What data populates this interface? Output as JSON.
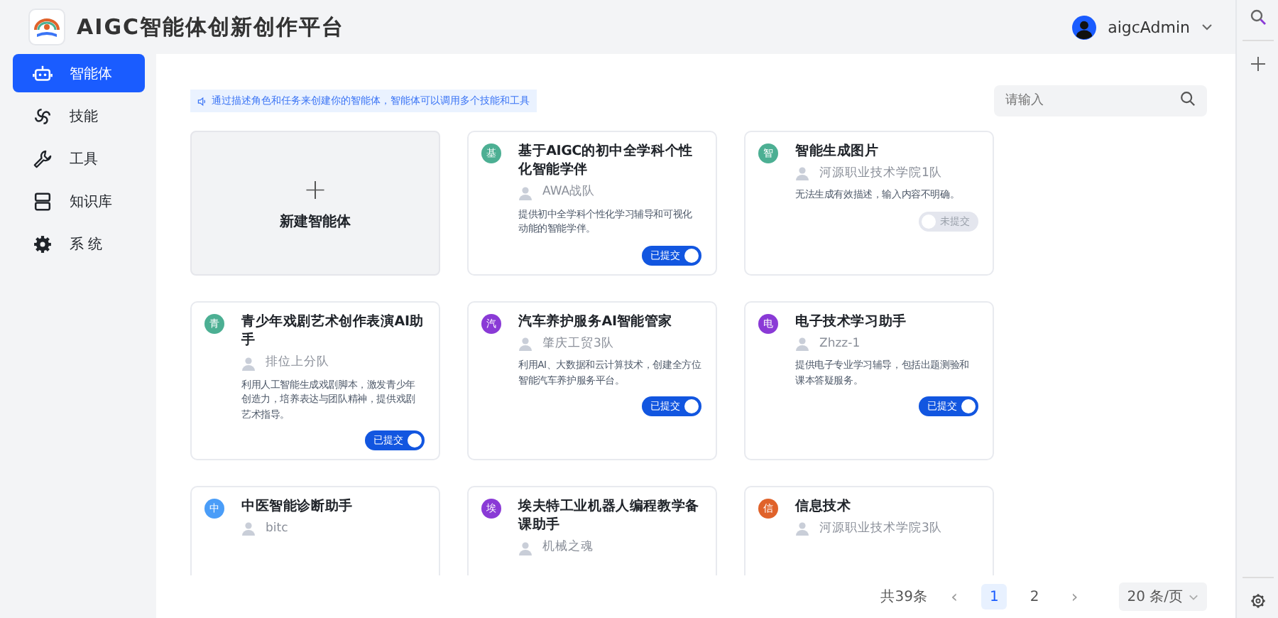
{
  "header": {
    "title": "AIGC智能体创新创作平台",
    "user": "aigcAdmin"
  },
  "sidebar": {
    "items": [
      {
        "label": "智能体",
        "selected": true
      },
      {
        "label": "技能",
        "selected": false
      },
      {
        "label": "工具",
        "selected": false
      },
      {
        "label": "知识库",
        "selected": false
      },
      {
        "label": "系 统",
        "selected": false
      }
    ]
  },
  "notice": "通过描述角色和任务来创建你的智能体，智能体可以调用多个技能和工具",
  "search": {
    "placeholder": "请输入"
  },
  "new_card": {
    "plus": "+",
    "label": "新建智能体"
  },
  "agents": [
    {
      "badge": "基",
      "color": "#4caf93",
      "title": "基于AIGC的初中全学科个性化智能学伴",
      "team": "AWA战队",
      "description": "提供初中全学科个性化学习辅导和可视化动能的智能学伴。",
      "status": {
        "label": "已提交",
        "on": true
      }
    },
    {
      "badge": "智",
      "color": "#4caf93",
      "title": "智能生成图片",
      "team": "河源职业技术学院1队",
      "description": "无法生成有效描述，输入内容不明确。",
      "status": {
        "label": "未提交",
        "on": false
      }
    },
    {
      "badge": "青",
      "color": "#4caf93",
      "title": "青少年戏剧艺术创作表演AI助手",
      "team": "排位上分队",
      "description": "利用人工智能生成戏剧脚本，激发青少年创造力，培养表达与团队精神，提供戏剧艺术指导。",
      "status": {
        "label": "已提交",
        "on": true
      }
    },
    {
      "badge": "汽",
      "color": "#8a3ad6",
      "title": "汽车养护服务AI智能管家",
      "team": "肇庆工贸3队",
      "description": "利用AI、大数据和云计算技术，创建全方位智能汽车养护服务平台。",
      "status": {
        "label": "已提交",
        "on": true
      }
    },
    {
      "badge": "电",
      "color": "#8a3ad6",
      "title": "电子技术学习助手",
      "team": "Zhzz-1",
      "description": "提供电子专业学习辅导，包括出题测验和课本答疑服务。",
      "status": {
        "label": "已提交",
        "on": true
      }
    },
    {
      "badge": "中",
      "color": "#4a9df8",
      "title": "中医智能诊断助手",
      "team": "bitc"
    },
    {
      "badge": "埃",
      "color": "#8a3ad6",
      "title": "埃夫特工业机器人编程教学备课助手",
      "team": "机械之魂"
    },
    {
      "badge": "信",
      "color": "#e0622a",
      "title": "信息技术",
      "team": "河源职业技术学院3队"
    }
  ],
  "pagination": {
    "total": "共39条",
    "prev": "‹",
    "next": "›",
    "pages": [
      {
        "label": "1",
        "selected": true
      },
      {
        "label": "2",
        "selected": false
      }
    ],
    "page_size": "20 条/页"
  }
}
